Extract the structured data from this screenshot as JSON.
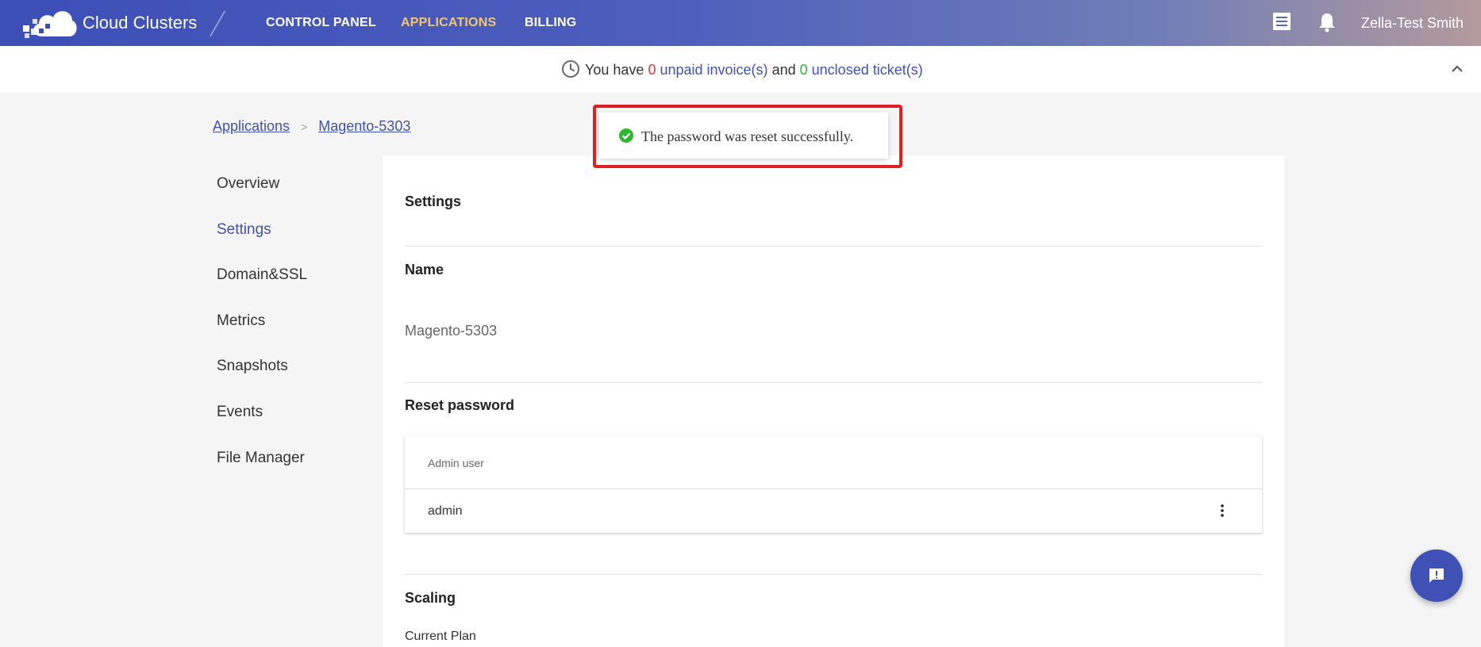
{
  "header": {
    "brand": "Cloud Clusters",
    "nav": [
      {
        "label": "CONTROL PANEL",
        "active": false
      },
      {
        "label": "APPLICATIONS",
        "active": true
      },
      {
        "label": "BILLING",
        "active": false
      }
    ],
    "user_name": "Zella-Test Smith",
    "icons": [
      "invoice-list-icon",
      "bell-icon"
    ]
  },
  "notice": {
    "prefix": "You have",
    "invoice_count": "0",
    "invoice_label": "unpaid invoice(s)",
    "middle": "and",
    "ticket_count": "0",
    "ticket_label": "unclosed ticket(s)"
  },
  "breadcrumb": {
    "root": "Applications",
    "separator": ">",
    "current": "Magento-5303"
  },
  "sidebar": {
    "items": [
      {
        "label": "Overview"
      },
      {
        "label": "Settings",
        "active": true
      },
      {
        "label": "Domain&SSL"
      },
      {
        "label": "Metrics"
      },
      {
        "label": "Snapshots"
      },
      {
        "label": "Events"
      },
      {
        "label": "File Manager"
      }
    ]
  },
  "settings": {
    "title": "Settings",
    "name_label": "Name",
    "name_value": "Magento-5303",
    "reset_label": "Reset password",
    "table": {
      "header": "Admin user",
      "rows": [
        {
          "user": "admin"
        }
      ]
    },
    "scaling_label": "Scaling",
    "current_plan_label": "Current Plan"
  },
  "toast": {
    "message": "The password was reset successfully."
  },
  "colors": {
    "primary": "#3f51b5",
    "active_nav": "#f5c66b",
    "count_red": "#e53935",
    "count_green": "#2eb82e",
    "highlight": "#e02020"
  }
}
